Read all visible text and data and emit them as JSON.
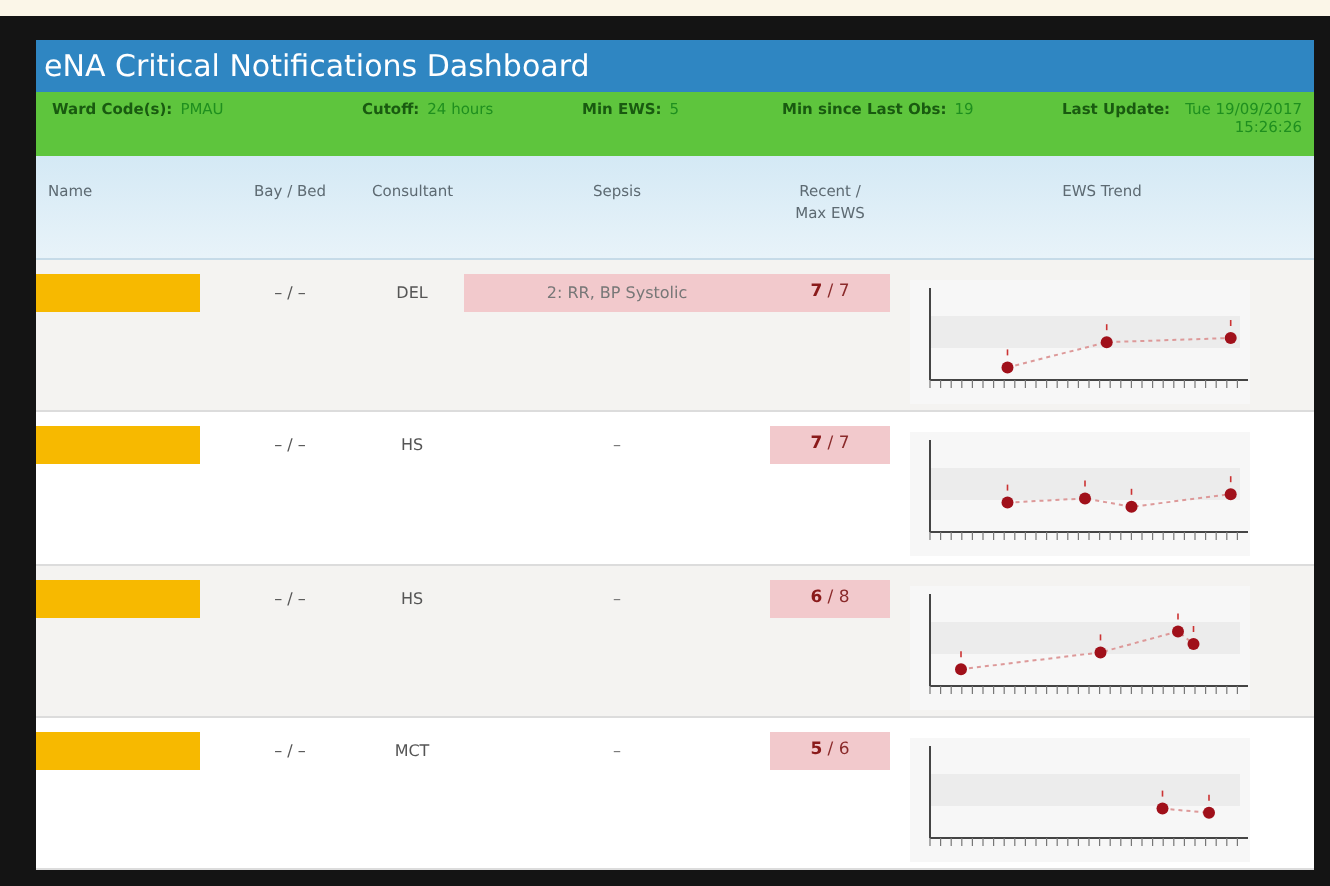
{
  "window": {
    "title": "eNA Critical Notifications Dashboard"
  },
  "filters": [
    {
      "label": "Ward Code(s):",
      "value": "PMAU"
    },
    {
      "label": "Cutoff:",
      "value": "24 hours"
    },
    {
      "label": "Min EWS:",
      "value": "5"
    },
    {
      "label": "Min since Last Obs:",
      "value": "19"
    },
    {
      "label": "Last Update:",
      "value": "Tue 19/09/2017 15:26:26"
    }
  ],
  "table": {
    "columns": [
      "Name",
      "Bay / Bed",
      "Consultant",
      "Sepsis",
      "Recent / Max EWS",
      "EWS Trend"
    ],
    "rows": [
      {
        "bay_bed": "– / –",
        "consultant": "DEL",
        "sepsis": "2: RR, BP Systolic",
        "sepsis_alert": true,
        "ews": "**7** / 7"
      },
      {
        "bay_bed": "– / –",
        "consultant": "HS",
        "sepsis": "–",
        "sepsis_alert": false,
        "ews": "**7** / 7"
      },
      {
        "bay_bed": "– / –",
        "consultant": "HS",
        "sepsis": "–",
        "sepsis_alert": false,
        "ews": "**6** / 8"
      },
      {
        "bay_bed": "– / –",
        "consultant": "MCT",
        "sepsis": "–",
        "sepsis_alert": false,
        "ews": "**5** / 6"
      }
    ]
  }
}
